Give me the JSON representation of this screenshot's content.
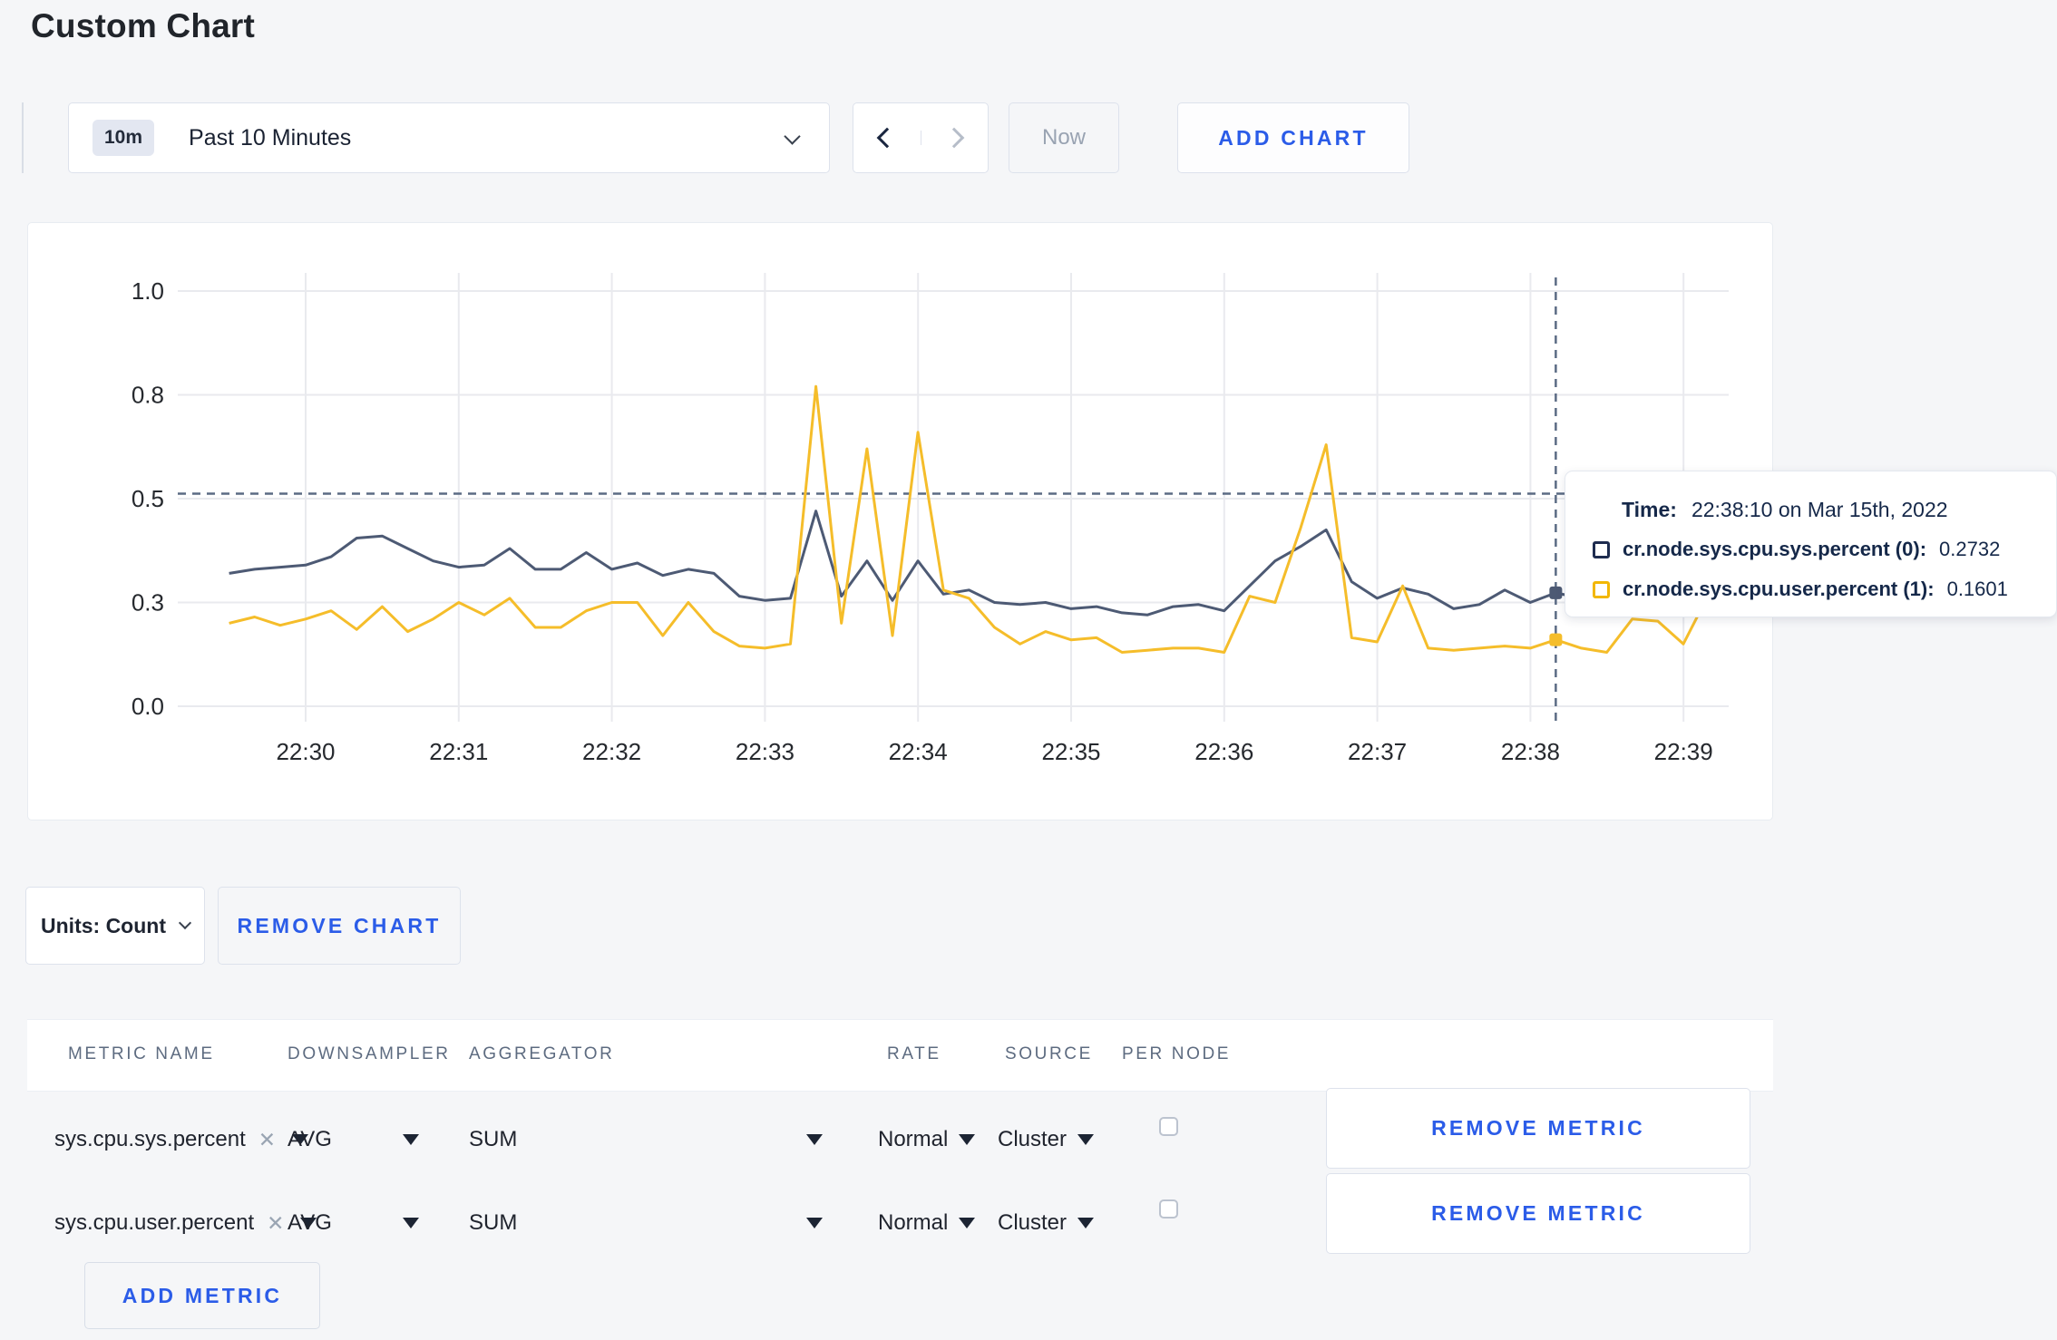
{
  "page_title": "Custom Chart",
  "toolbar": {
    "time_badge": "10m",
    "time_label": "Past 10 Minutes",
    "now_label": "Now",
    "add_chart_label": "ADD CHART"
  },
  "chart_data": {
    "type": "line",
    "title": "",
    "xlabel": "",
    "ylabel": "",
    "ylim": [
      0,
      1.0
    ],
    "grid": true,
    "x_start": "22:29:30",
    "x_interval_seconds": 10,
    "x_tick_labels": [
      "22:30",
      "22:31",
      "22:32",
      "22:33",
      "22:34",
      "22:35",
      "22:36",
      "22:37",
      "22:38",
      "22:39"
    ],
    "y_tick_values": [
      0,
      0.25,
      0.5,
      0.75,
      1.0
    ],
    "y_tick_labels": [
      "0.0",
      "0.3",
      "0.5",
      "0.8",
      "1.0"
    ],
    "series": [
      {
        "name": "cr.node.sys.cpu.sys.percent (0)",
        "color": "#4d5a74",
        "values": [
          0.32,
          0.33,
          0.335,
          0.34,
          0.36,
          0.405,
          0.41,
          0.38,
          0.35,
          0.335,
          0.34,
          0.38,
          0.33,
          0.33,
          0.37,
          0.33,
          0.345,
          0.315,
          0.33,
          0.32,
          0.265,
          0.255,
          0.26,
          0.47,
          0.265,
          0.35,
          0.255,
          0.35,
          0.27,
          0.28,
          0.25,
          0.245,
          0.25,
          0.235,
          0.24,
          0.225,
          0.22,
          0.24,
          0.245,
          0.23,
          0.29,
          0.35,
          0.385,
          0.425,
          0.3,
          0.26,
          0.285,
          0.27,
          0.235,
          0.245,
          0.28,
          0.25,
          0.2732,
          0.26,
          0.28,
          0.3,
          0.29,
          0.3,
          0.32
        ]
      },
      {
        "name": "cr.node.sys.cpu.user.percent (1)",
        "color": "#f5bd2a",
        "values": [
          0.2,
          0.215,
          0.195,
          0.21,
          0.23,
          0.185,
          0.24,
          0.18,
          0.21,
          0.25,
          0.22,
          0.26,
          0.19,
          0.19,
          0.23,
          0.25,
          0.25,
          0.17,
          0.25,
          0.18,
          0.145,
          0.14,
          0.15,
          0.77,
          0.2,
          0.62,
          0.17,
          0.66,
          0.28,
          0.26,
          0.19,
          0.15,
          0.18,
          0.16,
          0.165,
          0.13,
          0.135,
          0.14,
          0.14,
          0.13,
          0.265,
          0.25,
          0.43,
          0.63,
          0.165,
          0.155,
          0.29,
          0.14,
          0.135,
          0.14,
          0.145,
          0.14,
          0.1601,
          0.14,
          0.13,
          0.21,
          0.205,
          0.15,
          0.27
        ]
      }
    ],
    "crosshair": {
      "point_index": 52,
      "h_line_value": 0.512
    }
  },
  "tooltip": {
    "time_label": "Time:",
    "time_value": "22:38:10 on Mar 15th, 2022",
    "series": [
      {
        "label": "cr.node.sys.cpu.sys.percent (0):",
        "value": "0.2732",
        "swatch_color": "#1e2c4f"
      },
      {
        "label": "cr.node.sys.cpu.user.percent (1):",
        "value": "0.1601",
        "swatch_color": "#f2b705"
      }
    ]
  },
  "controls": {
    "units_label": "Units: Count",
    "remove_chart_label": "REMOVE CHART"
  },
  "metrics_table": {
    "headers": [
      "METRIC NAME",
      "DOWNSAMPLER",
      "AGGREGATOR",
      "RATE",
      "SOURCE",
      "PER NODE"
    ],
    "rows": [
      {
        "metric": "sys.cpu.sys.percent",
        "downsampler": "AVG",
        "aggregator": "SUM",
        "rate": "Normal",
        "source": "Cluster",
        "per_node_checked": false,
        "remove_label": "REMOVE METRIC"
      },
      {
        "metric": "sys.cpu.user.percent",
        "downsampler": "AVG",
        "aggregator": "SUM",
        "rate": "Normal",
        "source": "Cluster",
        "per_node_checked": false,
        "remove_label": "REMOVE METRIC"
      }
    ],
    "add_metric_label": "ADD METRIC"
  },
  "colors": {
    "accent_blue": "#2b5ce8",
    "navy_text": "#152849",
    "grid": "#e9eaee",
    "crosshair": "#5b6b84",
    "axis_label": "#26292e"
  }
}
